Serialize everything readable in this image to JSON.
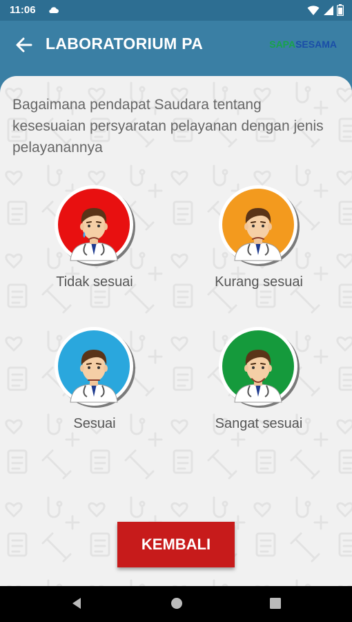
{
  "status": {
    "time": "11:06"
  },
  "header": {
    "title": "LABORATORIUM PA",
    "logo_part1": "SAPA",
    "logo_part2": "SESAMA"
  },
  "question": "Bagaimana pendapat Saudara tentang kesesuaian persyaratan pelayanan dengan jenis pelayanannya",
  "options": [
    {
      "label": "Tidak sesuai",
      "color": "#e81010",
      "mood": "crying"
    },
    {
      "label": "Kurang sesuai",
      "color": "#f39a1e",
      "mood": "sad"
    },
    {
      "label": "Sesuai",
      "color": "#2aa7dd",
      "mood": "neutral"
    },
    {
      "label": "Sangat sesuai",
      "color": "#159a3c",
      "mood": "smile"
    }
  ],
  "button": {
    "label": "KEMBALI"
  },
  "colors": {
    "app_bar": "#3a7fa4",
    "button": "#c71b1b",
    "background": "#f1f1f1"
  }
}
